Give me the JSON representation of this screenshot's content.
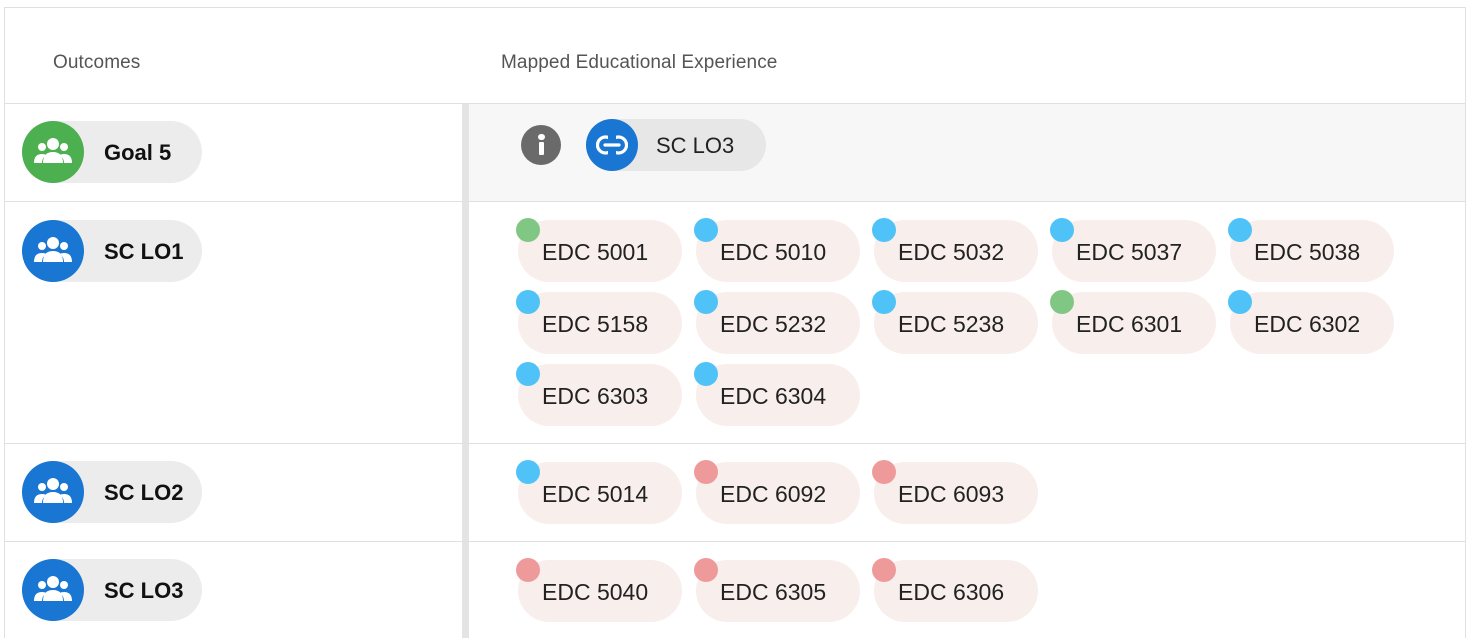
{
  "header": {
    "outcomes_label": "Outcomes",
    "mapped_label": "Mapped Educational Experience"
  },
  "colors": {
    "green_avatar": "#4caf50",
    "blue_avatar": "#1976d2",
    "dot_green": "#81c784",
    "dot_blue": "#4fc3f7",
    "dot_red": "#ef9a9a",
    "chip_bg": "#f8efec"
  },
  "rows": [
    {
      "outcome": "Goal 5",
      "avatar_color": "green",
      "avatar_icon": "people-icon",
      "info_icon": "info-icon",
      "link": {
        "icon": "link-icon",
        "label": "SC LO3"
      }
    },
    {
      "outcome": "SC LO1",
      "avatar_color": "blue",
      "avatar_icon": "people-icon",
      "courses": [
        {
          "code": "EDC 5001",
          "dot": "green"
        },
        {
          "code": "EDC 5010",
          "dot": "blue"
        },
        {
          "code": "EDC 5032",
          "dot": "blue"
        },
        {
          "code": "EDC 5037",
          "dot": "blue"
        },
        {
          "code": "EDC 5038",
          "dot": "blue"
        },
        {
          "code": "EDC 5158",
          "dot": "blue"
        },
        {
          "code": "EDC 5232",
          "dot": "blue"
        },
        {
          "code": "EDC 5238",
          "dot": "blue"
        },
        {
          "code": "EDC 6301",
          "dot": "green"
        },
        {
          "code": "EDC 6302",
          "dot": "blue"
        },
        {
          "code": "EDC 6303",
          "dot": "blue"
        },
        {
          "code": "EDC 6304",
          "dot": "blue"
        }
      ]
    },
    {
      "outcome": "SC LO2",
      "avatar_color": "blue",
      "avatar_icon": "people-icon",
      "courses": [
        {
          "code": "EDC 5014",
          "dot": "blue"
        },
        {
          "code": "EDC 6092",
          "dot": "red"
        },
        {
          "code": "EDC 6093",
          "dot": "red"
        }
      ]
    },
    {
      "outcome": "SC LO3",
      "avatar_color": "blue",
      "avatar_icon": "people-icon",
      "courses": [
        {
          "code": "EDC 5040",
          "dot": "red"
        },
        {
          "code": "EDC 6305",
          "dot": "red"
        },
        {
          "code": "EDC 6306",
          "dot": "red"
        }
      ]
    }
  ]
}
